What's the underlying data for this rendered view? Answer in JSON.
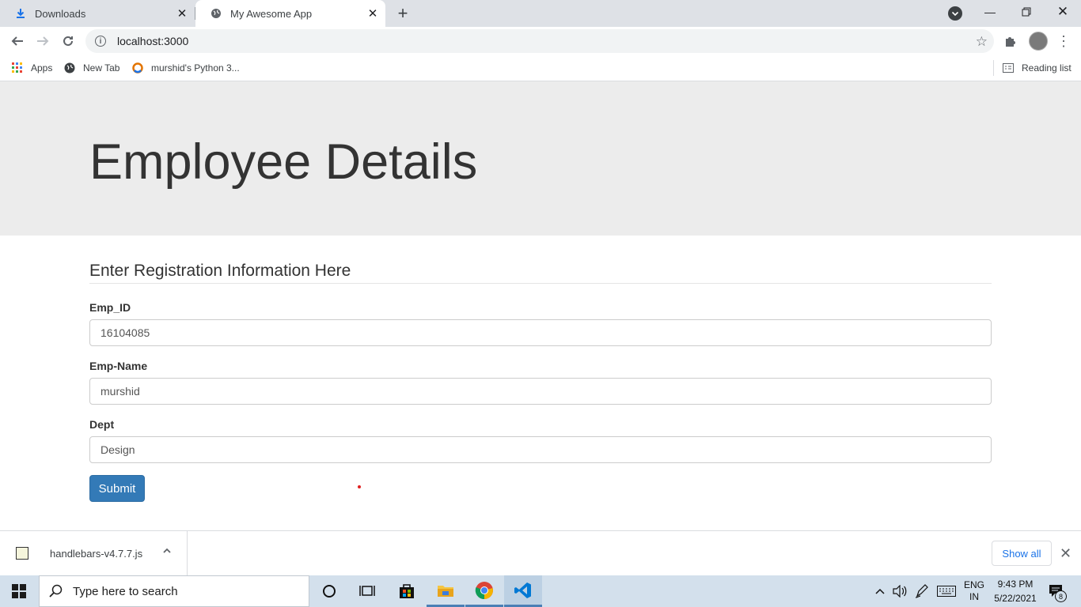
{
  "browser": {
    "tabs": [
      {
        "label": "Downloads"
      },
      {
        "label": "My Awesome App"
      }
    ],
    "address": "localhost:3000",
    "bookmarks": [
      {
        "label": "Apps"
      },
      {
        "label": "New Tab"
      },
      {
        "label": "murshid's Python 3..."
      }
    ],
    "reading_list": "Reading list"
  },
  "page": {
    "title": "Employee Details",
    "legend": "Enter Registration Information Here",
    "fields": [
      {
        "label": "Emp_ID",
        "value": "16104085"
      },
      {
        "label": "Emp-Name",
        "value": "murshid"
      },
      {
        "label": "Dept",
        "value": "Design"
      }
    ],
    "submit_label": "Submit"
  },
  "downloads": {
    "filename": "handlebars-v4.7.7.js",
    "show_all": "Show all"
  },
  "taskbar": {
    "search_placeholder": "Type here to search",
    "lang_line1": "ENG",
    "lang_line2": "IN",
    "time": "9:43 PM",
    "date": "5/22/2021",
    "notification_count": "8"
  },
  "colors": {
    "primary_button": "#337ab7",
    "jumbotron_bg": "#ececec",
    "taskbar_bg": "#d3e0ec"
  }
}
